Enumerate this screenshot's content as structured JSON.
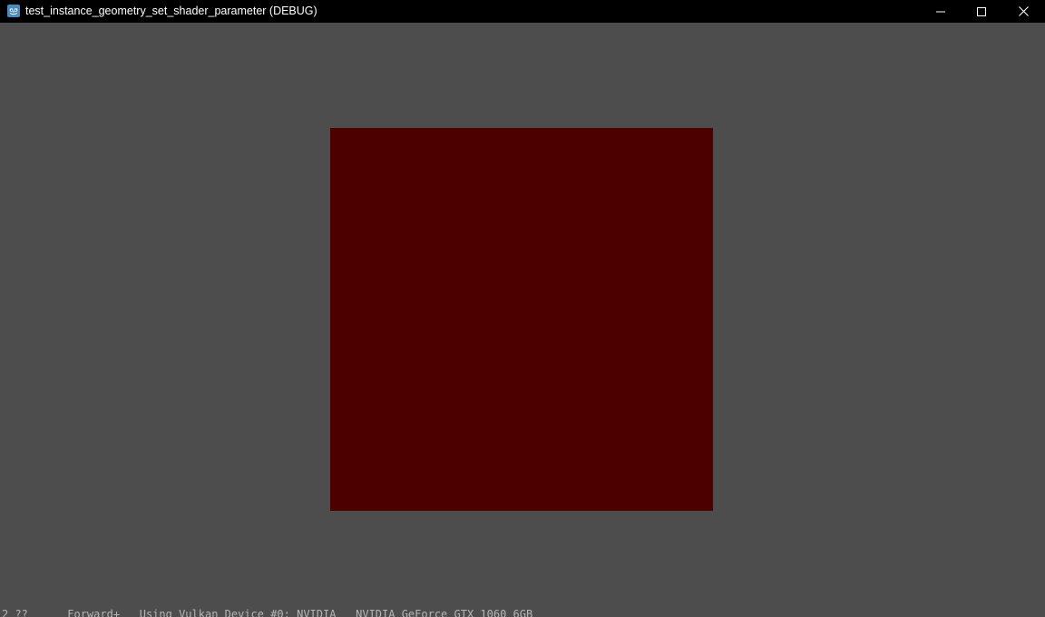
{
  "window": {
    "title": "test_instance_geometry_set_shader_parameter (DEBUG)",
    "app_icon": "godot-icon",
    "controls": {
      "minimize_icon": "minimize-icon",
      "maximize_icon": "maximize-icon",
      "close_icon": "close-icon"
    }
  },
  "colors": {
    "background": "#4d4d4d",
    "titlebar": "#000000",
    "square": "#4c0000"
  },
  "viewport": {
    "console_text": "2 ??      Forward+   Using Vulkan Device #0: NVIDIA   NVIDIA GeForce GTX 1060 6GB"
  }
}
